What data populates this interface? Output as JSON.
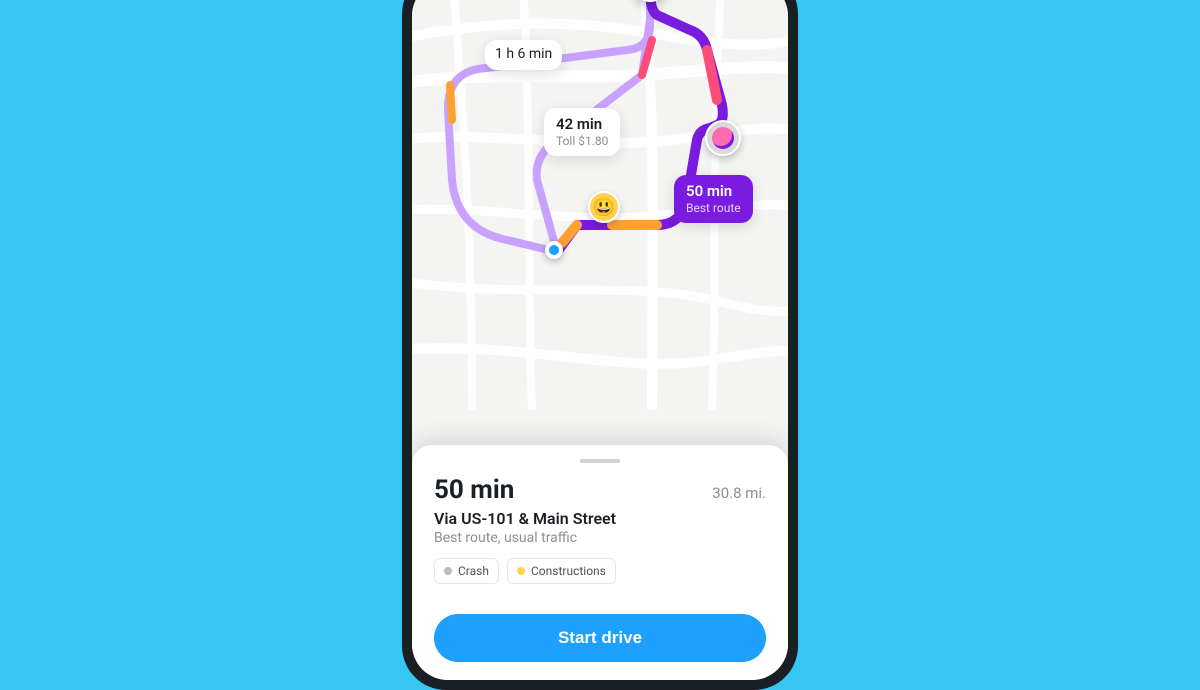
{
  "map": {
    "route_alt1": {
      "time": "1 h 6 min"
    },
    "route_alt2": {
      "time": "42 min",
      "toll": "Toll $1.80"
    },
    "route_best": {
      "time": "50 min",
      "sub": "Best route"
    }
  },
  "panel": {
    "eta": "50 min",
    "distance": "30.8 mi.",
    "via": "Via US-101 & Main Street",
    "subinfo": "Best route, usual traffic",
    "chips": {
      "crash": "Crash",
      "constructions": "Constructions"
    },
    "start_label": "Start drive"
  },
  "icons": {
    "hazard_face": "😃"
  }
}
